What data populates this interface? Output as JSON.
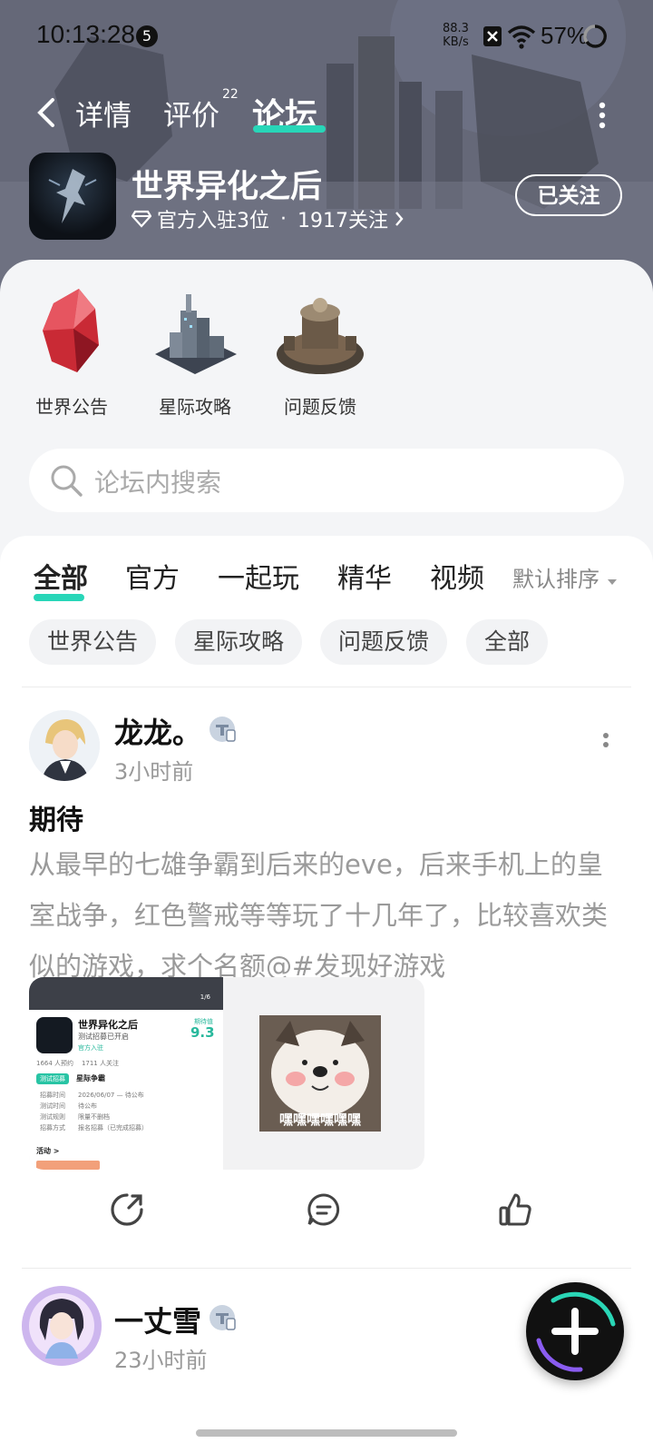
{
  "status_bar": {
    "time": "10:13:28",
    "notification_count": "5",
    "net_speed_value": "88.3",
    "net_speed_unit": "KB/s",
    "battery": "57%"
  },
  "nav": {
    "tabs": [
      {
        "label": "详情"
      },
      {
        "label": "评价"
      },
      {
        "label": "论坛"
      }
    ],
    "review_count": "22",
    "active_tab": "论坛"
  },
  "game": {
    "title": "世界异化之后",
    "official_label": "官方入驻3位",
    "separator": "·",
    "followers": "1917关注",
    "follow_button": "已关注"
  },
  "categories": [
    {
      "label": "世界公告",
      "icon": "red-crystal-icon"
    },
    {
      "label": "星际攻略",
      "icon": "city-tower-icon"
    },
    {
      "label": "问题反馈",
      "icon": "machine-base-icon"
    }
  ],
  "search": {
    "placeholder": "论坛内搜索"
  },
  "feed_tabs": [
    {
      "label": "全部"
    },
    {
      "label": "官方"
    },
    {
      "label": "一起玩"
    },
    {
      "label": "精华"
    },
    {
      "label": "视频"
    }
  ],
  "sort_label": "默认排序",
  "chips": [
    {
      "label": "世界公告"
    },
    {
      "label": "星际攻略"
    },
    {
      "label": "问题反馈"
    },
    {
      "label": "全部"
    }
  ],
  "posts": [
    {
      "author": "龙龙。",
      "time": "3小时前",
      "title": "期待",
      "body": "从最早的七雄争霸到后来的eve，后来手机上的皇室战争，红色警戒等等玩了十几年了，比较喜欢类似的游戏，求个名额@#发现好游戏",
      "screenshot": {
        "game_title": "世界异化之后",
        "status": "测试招募已开启",
        "official": "官方入驻",
        "score_label": "期待值",
        "score": "9.3",
        "stats": "1664 人预约    1711 人关注",
        "recruit_tag": "测试招募",
        "recruit_title": "星际争霸",
        "rows": [
          {
            "k": "招募时间",
            "v": "2026/06/07 — 待公布"
          },
          {
            "k": "测试时间",
            "v": "待公布"
          },
          {
            "k": "测试规则",
            "v": "限量不删档"
          },
          {
            "k": "招募方式",
            "v": "报名招募（已完成招募）"
          }
        ],
        "activity_label": "活动 >",
        "page_indicator": "1/6"
      },
      "meme_caption": "嘿嘿嘿嘿嘿嘿"
    },
    {
      "author": "一丈雪",
      "time": "23小时前"
    }
  ],
  "colors": {
    "accent": "#28d6b8",
    "header_bg": "#6d7080",
    "fab_bg": "#111111"
  }
}
